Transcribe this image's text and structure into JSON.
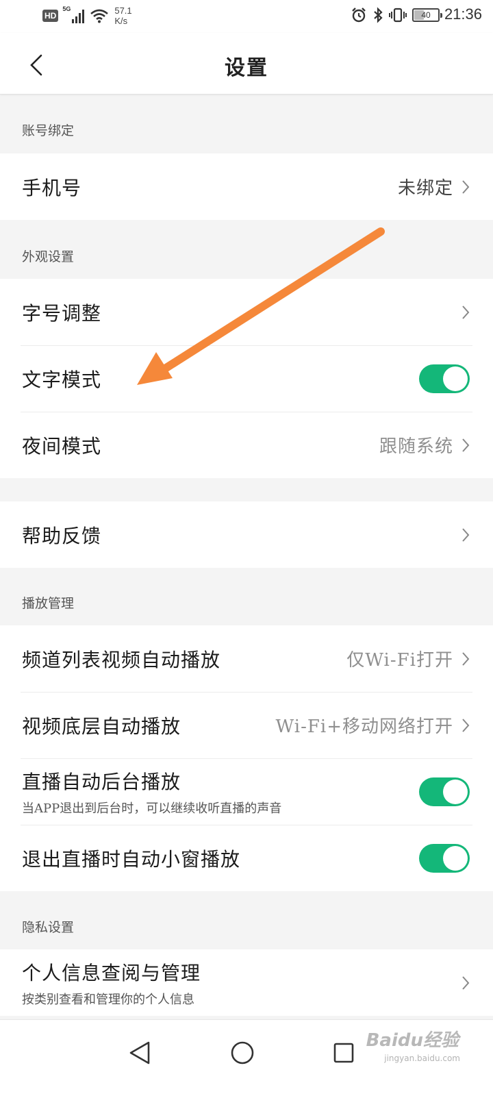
{
  "status_bar": {
    "hd": "HD",
    "network": "5G",
    "speed_value": "57.1",
    "speed_unit": "K/s",
    "battery": "40",
    "battery_level": 0.4,
    "time": "21:36"
  },
  "header": {
    "title": "设置"
  },
  "sections": {
    "account": {
      "label": "账号绑定",
      "phone": {
        "title": "手机号",
        "value": "未绑定"
      }
    },
    "appearance": {
      "label": "外观设置",
      "font_size": {
        "title": "字号调整"
      },
      "text_mode": {
        "title": "文字模式",
        "enabled": true
      },
      "night_mode": {
        "title": "夜间模式",
        "value": "跟随系统"
      }
    },
    "help": {
      "feedback": {
        "title": "帮助反馈"
      }
    },
    "playback": {
      "label": "播放管理",
      "channel_autoplay": {
        "title": "频道列表视频自动播放",
        "value": "仅Wi-Fi打开"
      },
      "video_bottom_autoplay": {
        "title": "视频底层自动播放",
        "value": "Wi-Fi+移动网络打开"
      },
      "live_background": {
        "title": "直播自动后台播放",
        "subtitle": "当APP退出到后台时，可以继续收听直播的声音",
        "enabled": true
      },
      "live_pip": {
        "title": "退出直播时自动小窗播放",
        "enabled": true
      }
    },
    "privacy": {
      "label": "隐私设置",
      "personal_info": {
        "title": "个人信息查阅与管理",
        "subtitle": "按类别查看和管理你的个人信息"
      }
    }
  },
  "watermark": {
    "brand": "Baidu经验",
    "site": "jingyan.baidu.com"
  },
  "colors": {
    "toggle_on": "#14b779",
    "annotation_arrow": "#f5883a",
    "background": "#f4f4f4"
  }
}
